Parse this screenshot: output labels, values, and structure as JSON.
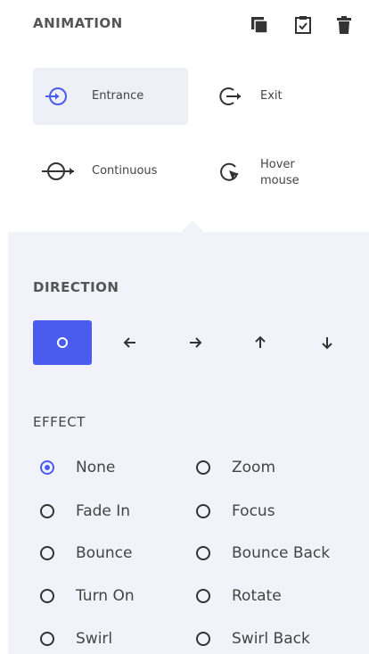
{
  "header": {
    "title": "ANIMATION",
    "icons": [
      "copy-icon",
      "paste-icon",
      "trash-icon"
    ]
  },
  "triggers": [
    {
      "label": "Entrance",
      "icon": "entrance-icon",
      "active": true
    },
    {
      "label": "Exit",
      "icon": "exit-icon",
      "active": false
    },
    {
      "label": "Continuous",
      "icon": "continuous-icon",
      "active": false
    },
    {
      "label": "Hover\nmouse",
      "icon": "hover-icon",
      "active": false
    }
  ],
  "direction": {
    "title": "DIRECTION",
    "buttons": [
      {
        "icon": "circle-icon",
        "active": true
      },
      {
        "icon": "arrow-left-icon",
        "active": false
      },
      {
        "icon": "arrow-right-icon",
        "active": false
      },
      {
        "icon": "arrow-up-icon",
        "active": false
      },
      {
        "icon": "arrow-down-icon",
        "active": false
      }
    ]
  },
  "effect": {
    "title": "EFFECT",
    "options": [
      {
        "label": "None",
        "checked": true
      },
      {
        "label": "Zoom",
        "checked": false
      },
      {
        "label": "Fade In",
        "checked": false
      },
      {
        "label": "Focus",
        "checked": false
      },
      {
        "label": "Bounce",
        "checked": false
      },
      {
        "label": "Bounce Back",
        "checked": false
      },
      {
        "label": "Turn On",
        "checked": false
      },
      {
        "label": "Rotate",
        "checked": false
      },
      {
        "label": "Swirl",
        "checked": false
      },
      {
        "label": "Swirl Back",
        "checked": false
      }
    ]
  },
  "colors": {
    "accent": "#4a5cf0",
    "panel": "#f2f3fa",
    "active_trigger": "#eef0f8"
  }
}
